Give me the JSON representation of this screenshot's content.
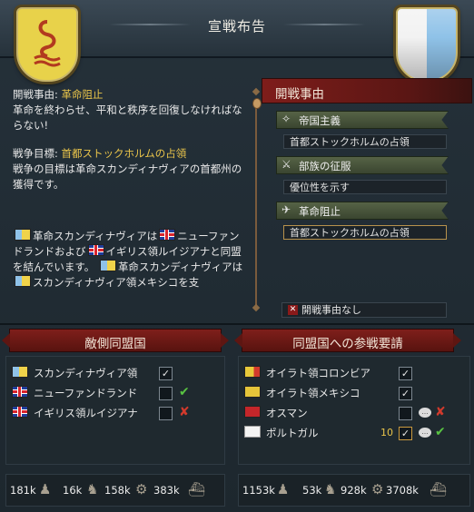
{
  "window": {
    "title": "宣戦布告"
  },
  "description": {
    "goal_label": "開戦事由:",
    "goal_value": "革命阻止",
    "goal_text": "革命を終わらせ、平和と秩序を回復しなければならない!",
    "target_label": "戦争目標:",
    "target_value": "首都ストックホルムの占領",
    "target_text": "戦争の目標は革命スカンディナヴィアの首都州の獲得です。",
    "alliance_text_1": "革命スカンディナヴィアは",
    "alliance_text_2": "ニューファンドランドおよび",
    "alliance_text_3": "イギリス領ルイジアナと同盟を結んでいます。",
    "alliance_text_4": "革命スカンディナヴィアは",
    "alliance_text_5": "スカンディナヴィア領メキシコを支"
  },
  "casus_belli": {
    "header": "開戦事由",
    "sections": [
      {
        "icon": "imperial-icon",
        "label": "帝国主義",
        "item": "首都ストックホルムの占領"
      },
      {
        "icon": "crossed-swords-icon",
        "label": "部族の征服",
        "item": "優位性を示す"
      },
      {
        "icon": "dove-icon",
        "label": "革命阻止",
        "item": "首都ストックホルムの占領"
      }
    ],
    "none_label": "開戦事由なし"
  },
  "enemy_allies": {
    "header": "敵側同盟国",
    "rows": [
      {
        "name": "スカンディナヴィア領",
        "flag": "scandinavia",
        "checked": true,
        "mark": ""
      },
      {
        "name": "ニューファンドランド",
        "flag": "uk",
        "checked": false,
        "mark": "ok"
      },
      {
        "name": "イギリス領ルイジアナ",
        "flag": "uk",
        "checked": false,
        "mark": "no"
      }
    ],
    "stats": {
      "army": "181k",
      "infantry": "16k",
      "cavalry": "158k",
      "artillery": "383k"
    }
  },
  "call_allies": {
    "header": "同盟国への参戦要請",
    "rows": [
      {
        "name": "オイラト領コロンビア",
        "flag": "oirat",
        "checked": true,
        "mark": ""
      },
      {
        "name": "オイラト領メキシコ",
        "flag": "yellow",
        "checked": true,
        "mark": ""
      },
      {
        "name": "オスマン",
        "flag": "ottoman",
        "checked": false,
        "mark": "no"
      },
      {
        "name": "ポルトガル",
        "flag": "portugal",
        "checked": true,
        "mark": "ok",
        "number": "10"
      }
    ],
    "stats": {
      "army": "1153k",
      "infantry": "53k",
      "cavalry": "928k",
      "artillery": "3708k"
    }
  }
}
